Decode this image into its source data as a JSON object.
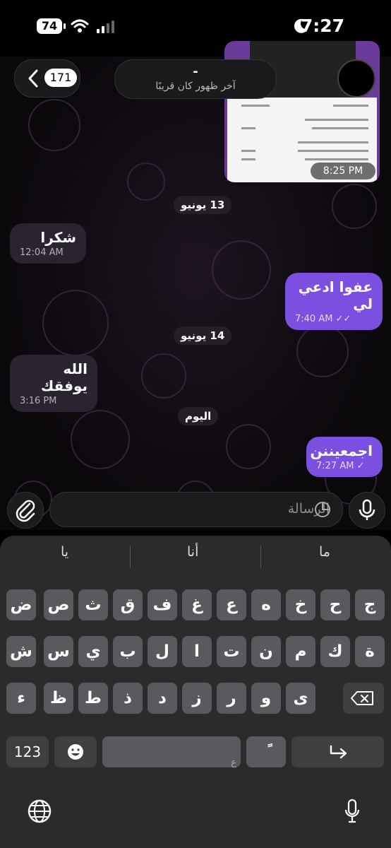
{
  "status_bar": {
    "battery": "74",
    "time": "7:27"
  },
  "header": {
    "back_badge": "171",
    "title": "-",
    "subtitle": "آخر ظهور كان قريبًا"
  },
  "messages": {
    "image_time": "8:25 PM",
    "date1": "13 يونيو",
    "m1_text": "شكرا",
    "m1_time": "12:04 AM",
    "m2_text": "عفوا ادعي لي",
    "m2_time": "7:40 AM",
    "date2": "14 يونيو",
    "m3_text": "الله يوفقك",
    "m3_time": "3:16 PM",
    "date3": "اليوم",
    "m4_text": "اجمعيننن",
    "m4_time": "7:27 AM"
  },
  "input": {
    "placeholder": "الرسالة"
  },
  "keyboard": {
    "suggestions": [
      "ما",
      "أنا",
      "يا"
    ],
    "row1": [
      "ج",
      "ح",
      "خ",
      "ه",
      "ع",
      "غ",
      "ف",
      "ق",
      "ث",
      "ص",
      "ض"
    ],
    "row2": [
      "ة",
      "ك",
      "م",
      "ن",
      "ت",
      "ا",
      "ل",
      "ب",
      "ي",
      "س",
      "ش"
    ],
    "row3": [
      "ى",
      "و",
      "ر",
      "ز",
      "د",
      "ذ",
      "ط",
      "ظ",
      "ء"
    ],
    "numbers_label": "123",
    "space_hint": "ع",
    "tanween_label": "ً"
  },
  "colors": {
    "outgoing": "#7b4fe0",
    "incoming": "#2a2330",
    "accent": "#7b4fe0"
  },
  "icons": [
    "wifi-icon",
    "signal-icon",
    "moon-icon",
    "back-chevron-icon",
    "attach-icon",
    "sticker-icon",
    "mic-icon",
    "delete-icon",
    "return-icon",
    "emoji-icon",
    "globe-icon",
    "dictation-icon"
  ]
}
